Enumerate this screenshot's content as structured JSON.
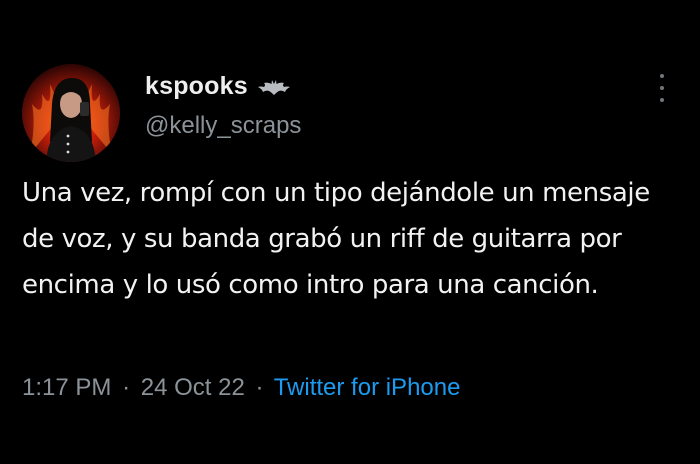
{
  "tweet": {
    "display_name": "kspooks",
    "badge_icon": "bat-icon",
    "handle": "@kelly_scraps",
    "text": "Una vez, rompí con un tipo dejándole un mensaje de voz, y su banda grabó un riff de guitarra por encima y lo usó como intro para una canción.",
    "time": "1:17 PM",
    "separator": "·",
    "date": "24 Oct 22",
    "source": "Twitter for iPhone"
  },
  "colors": {
    "background": "#000000",
    "text": "#f2f2f2",
    "secondary": "#8b9399",
    "link": "#1d9bf0"
  }
}
